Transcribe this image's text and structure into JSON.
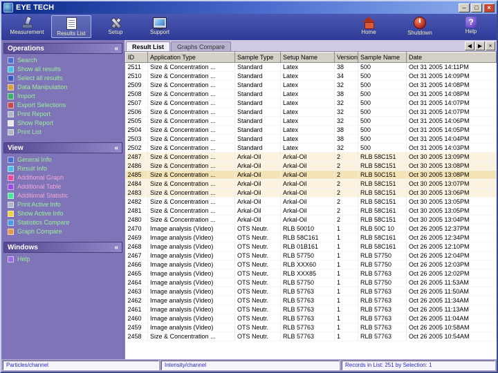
{
  "window": {
    "title": "EYE TECH",
    "controls": {
      "minimize": "–",
      "maximize": "□",
      "close": "×"
    }
  },
  "icons": {
    "collapse": "«",
    "tab_left": "◀",
    "tab_right": "▶",
    "tab_close": "×",
    "help_glyph": "?"
  },
  "colors": {
    "titlebar_start": "#0b2a8a",
    "titlebar_end": "#8fb0ee",
    "toolbar": "#3644a4",
    "sidebar": "#8074b8",
    "section_header": "#554a92",
    "cream_row": "#fbf3e0",
    "selected_row": "#f3e3b5",
    "status_text": "#2626c8",
    "sidebar_link_green": "#9af09a",
    "sidebar_link_pink": "#f2a6d8"
  },
  "toolbar": {
    "left": [
      {
        "label": "Measurement",
        "icon": "measurement-icon",
        "active": false
      },
      {
        "label": "Results List",
        "icon": "results-list-icon",
        "active": true
      },
      {
        "label": "Setup",
        "icon": "setup-icon",
        "active": false
      },
      {
        "label": "Support",
        "icon": "support-icon",
        "active": false
      }
    ],
    "right": [
      {
        "label": "Home",
        "icon": "home-icon"
      },
      {
        "label": "Shutdown",
        "icon": "shutdown-icon"
      },
      {
        "label": "Help",
        "icon": "help-icon"
      }
    ]
  },
  "sidebar": {
    "sections": [
      {
        "title": "Operations",
        "items": [
          {
            "label": "Search",
            "icon": "search-icon",
            "color": "green"
          },
          {
            "label": "Show all results",
            "icon": "show-all-results-icon",
            "color": "green"
          },
          {
            "label": "Select all results",
            "icon": "select-all-results-icon",
            "color": "green"
          },
          {
            "label": "Data Manipulation",
            "icon": "data-manipulation-icon",
            "color": "green"
          },
          {
            "label": "Import",
            "icon": "import-icon",
            "color": "green"
          },
          {
            "label": "Export Selections",
            "icon": "export-selections-icon",
            "color": "green"
          },
          {
            "label": "Print Report",
            "icon": "print-report-icon",
            "color": "green"
          },
          {
            "label": "Show Report",
            "icon": "show-report-icon",
            "color": "green"
          },
          {
            "label": "Print List",
            "icon": "print-list-icon",
            "color": "green"
          }
        ]
      },
      {
        "title": "View",
        "items": [
          {
            "label": "General Info",
            "icon": "general-info-icon",
            "color": "green"
          },
          {
            "label": "Result Info",
            "icon": "result-info-icon",
            "color": "green"
          },
          {
            "label": "Additional Graph",
            "icon": "additional-graph-icon",
            "color": "pink"
          },
          {
            "label": "Additional Table",
            "icon": "additional-table-icon",
            "color": "pink"
          },
          {
            "label": "Additional Statistic",
            "icon": "additional-statistic-icon",
            "color": "pink"
          },
          {
            "label": "Print Active Info",
            "icon": "print-active-info-icon",
            "color": "green"
          },
          {
            "label": "Show Active Info",
            "icon": "show-active-info-icon",
            "color": "green"
          },
          {
            "label": "Statistics Compare",
            "icon": "statistics-compare-icon",
            "color": "green"
          },
          {
            "label": "Graph Compare",
            "icon": "graph-compare-icon",
            "color": "green"
          }
        ]
      },
      {
        "title": "Windows",
        "items": [
          {
            "label": "Help",
            "icon": "help-window-icon",
            "color": "green"
          }
        ]
      }
    ]
  },
  "tabs": [
    {
      "label": "Result List",
      "active": true
    },
    {
      "label": "Graphs Compare",
      "active": false
    }
  ],
  "table": {
    "columns": [
      "ID",
      "Application Type",
      "Sample Type",
      "Setup Name",
      "Version",
      "Sample Name",
      "Date"
    ],
    "rows": [
      {
        "cells": [
          "2511",
          "Size & Concentration ...",
          "Standard",
          "Latex",
          "38",
          "500",
          "Oct 31 2005 14:11PM"
        ],
        "tone": "plain",
        "selected": false
      },
      {
        "cells": [
          "2510",
          "Size & Concentration ...",
          "Standard",
          "Latex",
          "34",
          "500",
          "Oct 31 2005 14:09PM"
        ],
        "tone": "plain",
        "selected": false
      },
      {
        "cells": [
          "2509",
          "Size & Concentration ...",
          "Standard",
          "Latex",
          "32",
          "500",
          "Oct 31 2005 14:08PM"
        ],
        "tone": "plain",
        "selected": false
      },
      {
        "cells": [
          "2508",
          "Size & Concentration ...",
          "Standard",
          "Latex",
          "38",
          "500",
          "Oct 31 2005 14:08PM"
        ],
        "tone": "plain",
        "selected": false
      },
      {
        "cells": [
          "2507",
          "Size & Concentration ...",
          "Standard",
          "Latex",
          "32",
          "500",
          "Oct 31 2005 14:07PM"
        ],
        "tone": "plain",
        "selected": false
      },
      {
        "cells": [
          "2506",
          "Size & Concentration ...",
          "Standard",
          "Latex",
          "32",
          "500",
          "Oct 31 2005 14:07PM"
        ],
        "tone": "plain",
        "selected": false
      },
      {
        "cells": [
          "2505",
          "Size & Concentration ...",
          "Standard",
          "Latex",
          "32",
          "500",
          "Oct 31 2005 14:06PM"
        ],
        "tone": "plain",
        "selected": false
      },
      {
        "cells": [
          "2504",
          "Size & Concentration ...",
          "Standard",
          "Latex",
          "38",
          "500",
          "Oct 31 2005 14:05PM"
        ],
        "tone": "plain",
        "selected": false
      },
      {
        "cells": [
          "2503",
          "Size & Concentration ...",
          "Standard",
          "Latex",
          "38",
          "500",
          "Oct 31 2005 14:04PM"
        ],
        "tone": "plain",
        "selected": false
      },
      {
        "cells": [
          "2502",
          "Size & Concentration ...",
          "Standard",
          "Latex",
          "32",
          "500",
          "Oct 31 2005 14:03PM"
        ],
        "tone": "plain",
        "selected": false
      },
      {
        "cells": [
          "2487",
          "Size & Concentration ...",
          "Arkal-Oil",
          "Arkal-Oil",
          "2",
          "RLB 58C151",
          "Oct 30 2005 13:09PM"
        ],
        "tone": "cream",
        "selected": false
      },
      {
        "cells": [
          "2486",
          "Size & Concentration ...",
          "Arkal-Oil",
          "Arkal-Oil",
          "2",
          "RLB 58C151",
          "Oct 30 2005 13:08PM"
        ],
        "tone": "cream",
        "selected": false
      },
      {
        "cells": [
          "2485",
          "Size & Concentration ...",
          "Arkal-Oil",
          "Arkal-Oil",
          "2",
          "RLB 50C151",
          "Oct 30 2005 13:08PM"
        ],
        "tone": "cream",
        "selected": true
      },
      {
        "cells": [
          "2484",
          "Size & Concentration ...",
          "Arkal-Oil",
          "Arkal-Oil",
          "2",
          "RLB 58C151",
          "Oct 30 2005 13:07PM"
        ],
        "tone": "cream",
        "selected": false
      },
      {
        "cells": [
          "2483",
          "Size & Concentration ...",
          "Arkal-Oil",
          "Arkal-Oil",
          "2",
          "RLB 58C151",
          "Oct 30 2005 13:06PM"
        ],
        "tone": "cream",
        "selected": false
      },
      {
        "cells": [
          "2482",
          "Size & Concentration ...",
          "Arkal-Oil",
          "Arkal-Oil",
          "2",
          "RLB 58C151",
          "Oct 30 2005 13:05PM"
        ],
        "tone": "plain",
        "selected": false
      },
      {
        "cells": [
          "2481",
          "Size & Concentration ...",
          "Arkal-Oil",
          "Arkal-Oil",
          "2",
          "RLB 58C161",
          "Oct 30 2005 13:05PM"
        ],
        "tone": "plain",
        "selected": false
      },
      {
        "cells": [
          "2480",
          "Size & Concentration ...",
          "Arkal-Oil",
          "Arkal-Oil",
          "2",
          "RLB 58C151",
          "Oct 30 2005 13:04PM"
        ],
        "tone": "plain",
        "selected": false
      },
      {
        "cells": [
          "2470",
          "Image analysis (Video)",
          "OTS Neutr.",
          "RLB 50010",
          "1",
          "RLB 50C 10",
          "Oct 26 2005 12:37PM"
        ],
        "tone": "plain",
        "selected": false
      },
      {
        "cells": [
          "2469",
          "Image analysis (Video)",
          "OTS Neutr.",
          "RLB 58C161",
          "1",
          "RLB 58C161",
          "Oct 26 2005 12:34PM"
        ],
        "tone": "plain",
        "selected": false
      },
      {
        "cells": [
          "2468",
          "Image analysis (Video)",
          "OTS Neutr.",
          "RLB 01B161",
          "1",
          "RLB 58C161",
          "Oct 26 2005 12:10PM"
        ],
        "tone": "plain",
        "selected": false
      },
      {
        "cells": [
          "2467",
          "Image analysis (Video)",
          "OTS Neutr.",
          "RLB 57750",
          "1",
          "RLB 57750",
          "Oct 26 2005 12:04PM"
        ],
        "tone": "plain",
        "selected": false
      },
      {
        "cells": [
          "2466",
          "Image analysis (Video)",
          "OTS Neutr.",
          "RLB XXX60",
          "1",
          "RLB 57750",
          "Oct 26 2005 12:03PM"
        ],
        "tone": "plain",
        "selected": false
      },
      {
        "cells": [
          "2465",
          "Image analysis (Video)",
          "OTS Neutr.",
          "RLB XXX85",
          "1",
          "RLB 57763",
          "Oct 26 2005 12:02PM"
        ],
        "tone": "plain",
        "selected": false
      },
      {
        "cells": [
          "2464",
          "Image analysis (Video)",
          "OTS Neutr.",
          "RLB 57750",
          "1",
          "RLB 57750",
          "Oct 26 2005 11:53AM"
        ],
        "tone": "plain",
        "selected": false
      },
      {
        "cells": [
          "2463",
          "Image analysis (Video)",
          "OTS Neutr.",
          "RLB 57763",
          "1",
          "RLB 57763",
          "Oct 26 2005 11:50AM"
        ],
        "tone": "plain",
        "selected": false
      },
      {
        "cells": [
          "2462",
          "Image analysis (Video)",
          "OTS Neutr.",
          "RLB 57763",
          "1",
          "RLB 57763",
          "Oct 26 2005 11:34AM"
        ],
        "tone": "plain",
        "selected": false
      },
      {
        "cells": [
          "2461",
          "Image analysis (Video)",
          "OTS Neutr.",
          "RLB 57763",
          "1",
          "RLB 57763",
          "Oct 26 2005 11:13AM"
        ],
        "tone": "plain",
        "selected": false
      },
      {
        "cells": [
          "2460",
          "Image analysis (Video)",
          "OTS Neutr.",
          "RLB 57763",
          "1",
          "RLB 57763",
          "Oct 26 2005 11:04AM"
        ],
        "tone": "plain",
        "selected": false
      },
      {
        "cells": [
          "2459",
          "Image analysis (Video)",
          "OTS Neutr.",
          "RLB 57763",
          "1",
          "RLB 57763",
          "Oct 26 2005 10:58AM"
        ],
        "tone": "plain",
        "selected": false
      },
      {
        "cells": [
          "2458",
          "Size & Concentration ...",
          "OTS Neutr.",
          "RLB 57763",
          "1",
          "RLB 57763",
          "Oct 26 2005 10:54AM"
        ],
        "tone": "plain",
        "selected": false
      }
    ]
  },
  "statusbar": {
    "left": "Particles/channel",
    "middle": "Intensity/channel",
    "right": "Records in List: 251 by Selection: 1"
  }
}
